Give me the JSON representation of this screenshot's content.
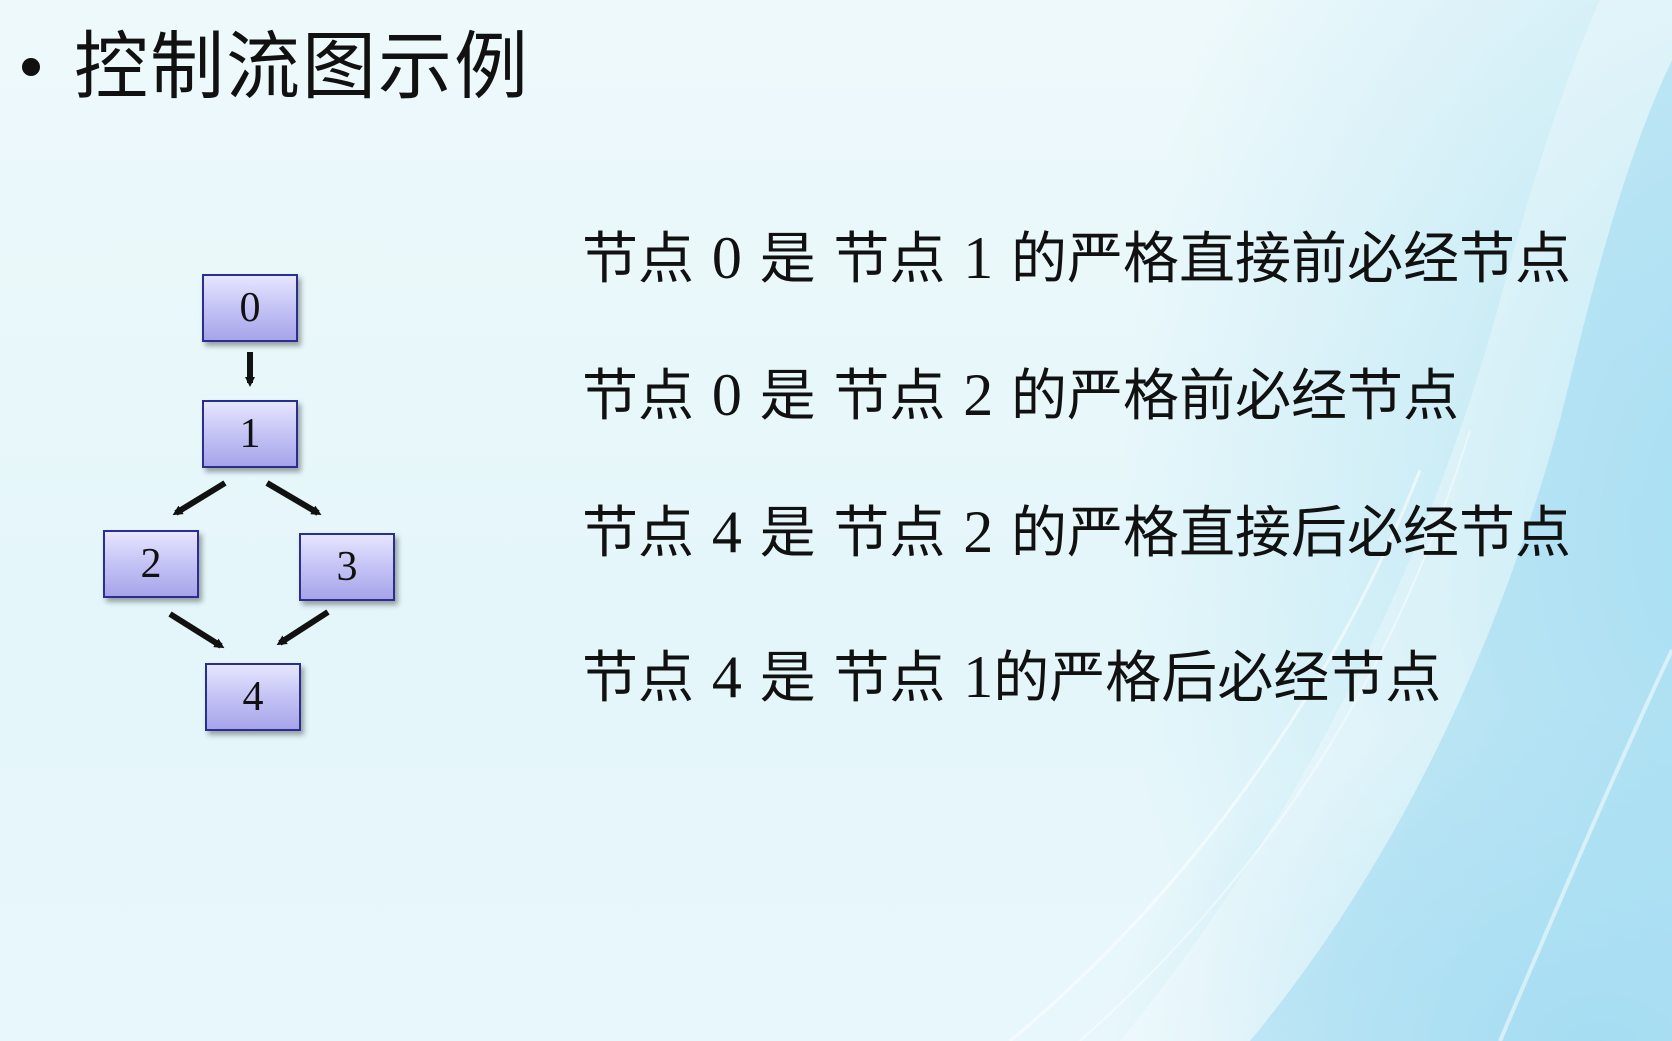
{
  "slide": {
    "title": "控制流图示例"
  },
  "graph": {
    "nodes": [
      {
        "id": "0",
        "label": "0"
      },
      {
        "id": "1",
        "label": "1"
      },
      {
        "id": "2",
        "label": "2"
      },
      {
        "id": "3",
        "label": "3"
      },
      {
        "id": "4",
        "label": "4"
      }
    ],
    "edges": [
      {
        "from": "0",
        "to": "1"
      },
      {
        "from": "1",
        "to": "2"
      },
      {
        "from": "1",
        "to": "3"
      },
      {
        "from": "2",
        "to": "4"
      },
      {
        "from": "3",
        "to": "4"
      }
    ]
  },
  "statements": [
    {
      "p1": "节点 ",
      "a": "0",
      "p2": " 是 节点 ",
      "b": "1",
      "p3": " 的严格直接前必经节点"
    },
    {
      "p1": "节点 ",
      "a": "0",
      "p2": " 是 节点 ",
      "b": "2",
      "p3": " 的严格前必经节点"
    },
    {
      "p1": "节点 ",
      "a": "4",
      "p2": " 是 节点 ",
      "b": "2",
      "p3": " 的严格直接后必经节点"
    },
    {
      "p1": "节点 ",
      "a": "4",
      "p2": " 是 节点 ",
      "b": "1",
      "p3": "的严格后必经节点"
    }
  ]
}
